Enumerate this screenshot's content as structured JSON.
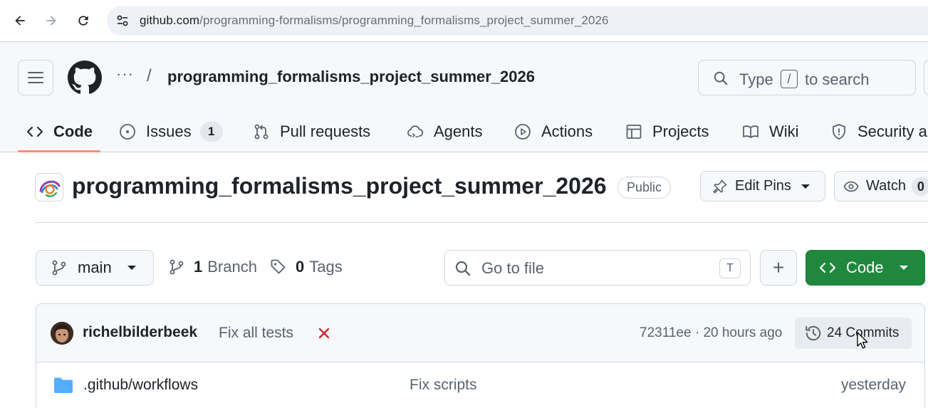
{
  "browser": {
    "url_host": "github.com",
    "url_path": "/programming-formalisms/programming_formalisms_project_summer_2026",
    "back_icon": "back-arrow-icon",
    "forward_icon": "forward-arrow-icon",
    "reload_icon": "reload-icon"
  },
  "header": {
    "owner_dots": "···",
    "separator": "/",
    "repo_name": "programming_formalisms_project_summer_2026",
    "search": {
      "prefix": "Type",
      "key": "/",
      "suffix": "to search"
    }
  },
  "tabs": [
    {
      "label": "Code",
      "icon": "code-icon",
      "active": true
    },
    {
      "label": "Issues",
      "icon": "issue-icon",
      "count": "1"
    },
    {
      "label": "Pull requests",
      "icon": "pull-request-icon"
    },
    {
      "label": "Agents",
      "icon": "agents-icon"
    },
    {
      "label": "Actions",
      "icon": "play-icon"
    },
    {
      "label": "Projects",
      "icon": "table-icon"
    },
    {
      "label": "Wiki",
      "icon": "book-icon"
    },
    {
      "label": "Security a",
      "icon": "shield-icon"
    }
  ],
  "repo": {
    "title": "programming_formalisms_project_summer_2026",
    "visibility": "Public",
    "edit_pins": "Edit Pins",
    "watch": "Watch",
    "watch_count": "0"
  },
  "toolbar": {
    "branch": "main",
    "branches_count": "1",
    "branches_label": "Branch",
    "tags_count": "0",
    "tags_label": "Tags",
    "goto_placeholder": "Go to file",
    "goto_key": "T",
    "add_label": "+",
    "code_label": "Code"
  },
  "last_commit": {
    "author": "richelbilderbeek",
    "message": "Fix all tests",
    "status": "failed",
    "sha": "72311ee",
    "time": "20 hours ago",
    "sep": "·",
    "commits_label": "24 Commits"
  },
  "files": [
    {
      "name": ".github/workflows",
      "type": "folder",
      "commit": "Fix scripts",
      "date": "yesterday"
    }
  ],
  "colors": {
    "primary_button": "#1f883d",
    "tab_underline": "#fd8c73",
    "fail_x": "#d1242f",
    "folder": "#54aeff"
  }
}
